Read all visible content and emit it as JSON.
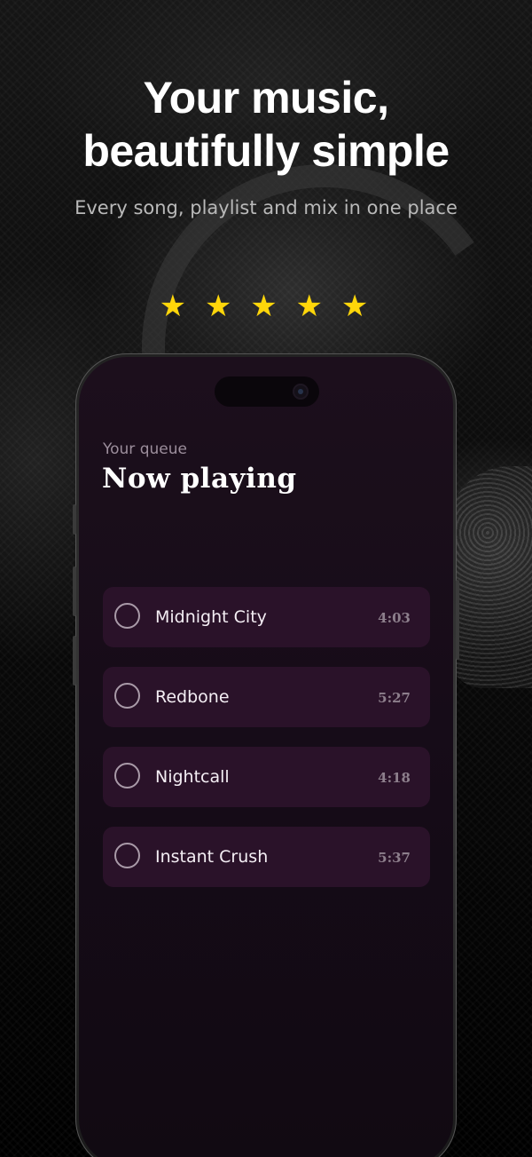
{
  "hero": {
    "title_line1": "Your music,",
    "title_line2": "beautifully simple",
    "subtitle": "Every song, playlist and mix in one place"
  },
  "rating": {
    "stars": [
      "★",
      "★",
      "★",
      "★",
      "★"
    ],
    "value": 5,
    "color": "#ffd60a"
  },
  "app": {
    "section_label": "Your queue",
    "heading": "Now playing",
    "songs": [
      {
        "title": "Midnight City",
        "duration": "4:03"
      },
      {
        "title": "Redbone",
        "duration": "5:27"
      },
      {
        "title": "Nightcall",
        "duration": "4:18"
      },
      {
        "title": "Instant Crush",
        "duration": "5:37"
      }
    ]
  },
  "colors": {
    "accent_star": "#ffd60a",
    "screen_bg": "#150b17",
    "card_bg": "#2a1229"
  }
}
